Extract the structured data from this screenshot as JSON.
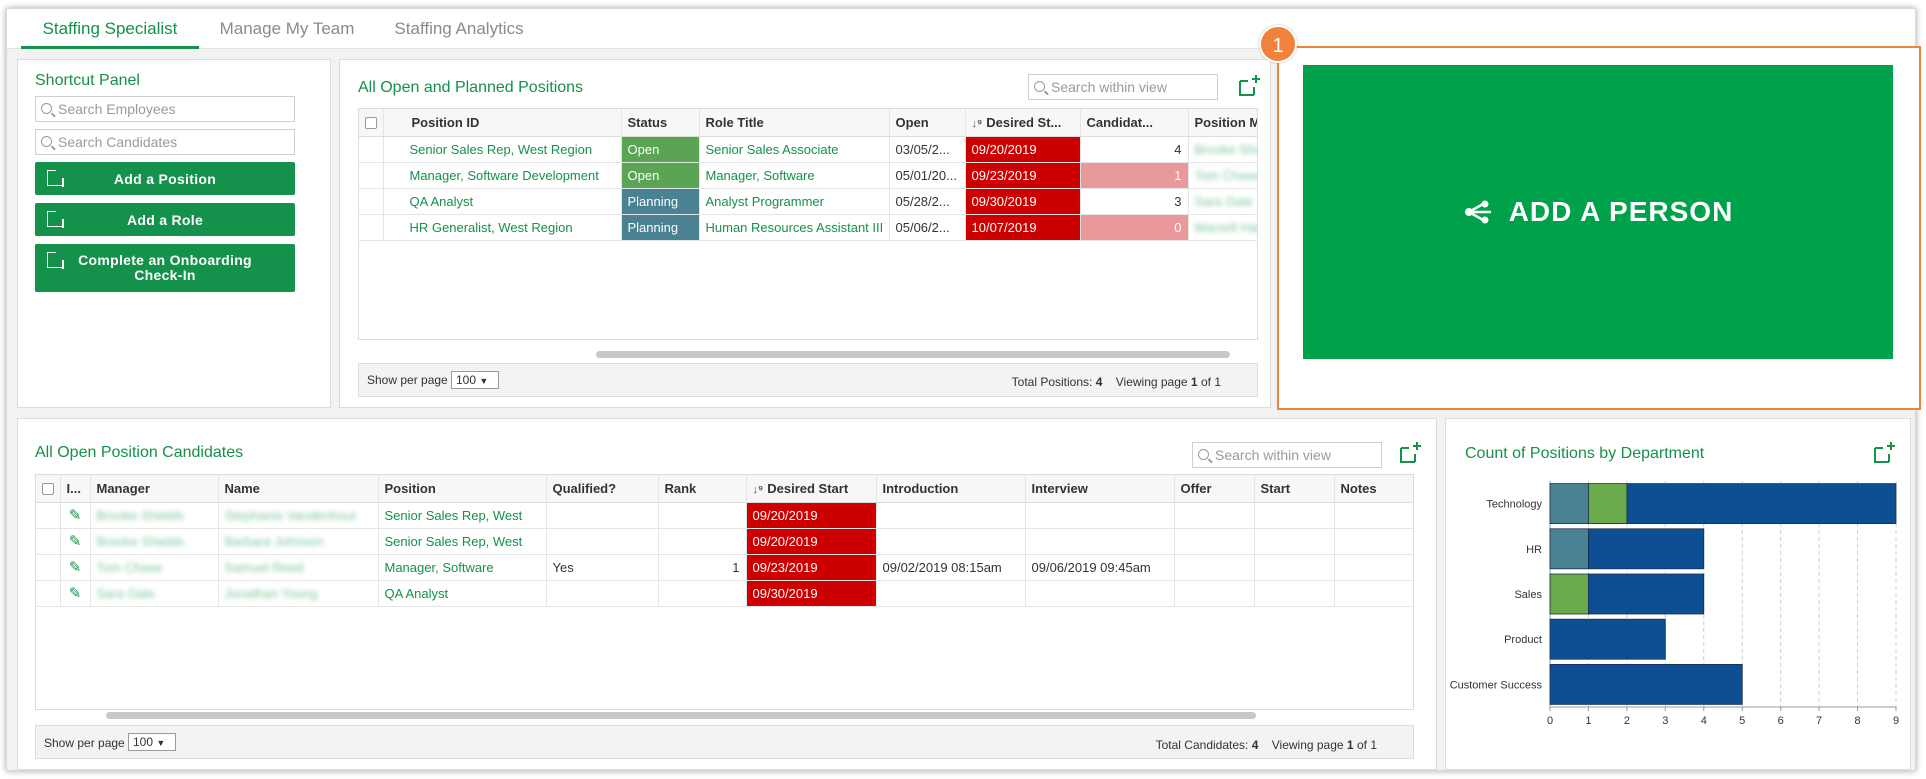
{
  "tabs": [
    {
      "label": "Staffing Specialist",
      "active": true
    },
    {
      "label": "Manage My Team",
      "active": false
    },
    {
      "label": "Staffing Analytics",
      "active": false
    }
  ],
  "shortcut_panel": {
    "title": "Shortcut Panel",
    "search_employees_placeholder": "Search Employees",
    "search_candidates_placeholder": "Search Candidates",
    "buttons": [
      "Add a Position",
      "Add a Role",
      "Complete an Onboarding Check-In"
    ]
  },
  "positions": {
    "title": "All Open and Planned Positions",
    "search_placeholder": "Search within view",
    "columns": [
      "Position ID",
      "Status",
      "Role Title",
      "Open",
      "Desired St...",
      "Candidat...",
      "Position Mana"
    ],
    "rows": [
      {
        "position_id": "Senior Sales Rep, West Region",
        "status": "Open",
        "role_title": "Senior Sales Associate",
        "open": "03/05/2...",
        "desired_start": "09/20/2019",
        "candidates": "4",
        "manager": "Brooke Shields"
      },
      {
        "position_id": "Manager, Software Development",
        "status": "Open",
        "role_title": "Manager, Software",
        "open": "05/01/20...",
        "desired_start": "09/23/2019",
        "candidates": "1",
        "manager": "Tom Chase"
      },
      {
        "position_id": "QA Analyst",
        "status": "Planning",
        "role_title": "Analyst Programmer",
        "open": "05/28/2...",
        "desired_start": "09/30/2019",
        "candidates": "3",
        "manager": "Sara Gale"
      },
      {
        "position_id": "HR Generalist, West Region",
        "status": "Planning",
        "role_title": "Human Resources Assistant III",
        "open": "05/06/2...",
        "desired_start": "10/07/2019",
        "candidates": "0",
        "manager": "Marnell Harris"
      }
    ],
    "show_per_page_label": "Show per page",
    "per_page": "100",
    "total_label": "Total Positions:",
    "total": "4",
    "viewing_label": "Viewing page",
    "page": "1",
    "of_label": "of",
    "pages": "1"
  },
  "add_person": {
    "label": "ADD A PERSON",
    "callout_number": "1",
    "accent": "#f0823c",
    "button_color": "#00a14b"
  },
  "candidates": {
    "title": "All Open Position Candidates",
    "search_placeholder": "Search within view",
    "columns": [
      "I...",
      "Manager",
      "Name",
      "Position",
      "Qualified?",
      "Rank",
      "Desired Start",
      "Introduction",
      "Interview",
      "Offer",
      "Start",
      "Notes"
    ],
    "rows": [
      {
        "manager": "Brooke Shields",
        "name": "Stephanie Vandenhout",
        "position": "Senior Sales Rep, West",
        "qualified": "",
        "rank": "",
        "desired_start": "09/20/2019",
        "introduction": "",
        "interview": "",
        "offer": "",
        "start": "",
        "notes": ""
      },
      {
        "manager": "Brooke Shields",
        "name": "Barbara Johnson",
        "position": "Senior Sales Rep, West",
        "qualified": "",
        "rank": "",
        "desired_start": "09/20/2019",
        "introduction": "",
        "interview": "",
        "offer": "",
        "start": "",
        "notes": ""
      },
      {
        "manager": "Tom Chase",
        "name": "Samuel Reed",
        "position": "Manager, Software",
        "qualified": "Yes",
        "rank": "1",
        "desired_start": "09/23/2019",
        "introduction": "09/02/2019 08:15am",
        "interview": "09/06/2019 09:45am",
        "offer": "",
        "start": "",
        "notes": ""
      },
      {
        "manager": "Sara Gale",
        "name": "Jonathan Young",
        "position": "QA Analyst",
        "qualified": "",
        "rank": "",
        "desired_start": "09/30/2019",
        "introduction": "",
        "interview": "",
        "offer": "",
        "start": "",
        "notes": ""
      }
    ],
    "show_per_page_label": "Show per page",
    "per_page": "100",
    "total_label": "Total Candidates:",
    "total": "4",
    "viewing_label": "Viewing page",
    "page": "1",
    "of_label": "of",
    "pages": "1"
  },
  "chart_data": {
    "type": "bar",
    "orientation": "horizontal",
    "stacked": true,
    "title": "Count of Positions by Department",
    "categories": [
      "Technology",
      "HR",
      "Sales",
      "Product",
      "Customer Success"
    ],
    "series": [
      {
        "color": "#4a8193",
        "values": [
          1,
          1,
          0,
          0,
          0
        ]
      },
      {
        "color": "#6aaa4a",
        "values": [
          1,
          0,
          1,
          0,
          0
        ]
      },
      {
        "color": "#0e4f94",
        "values": [
          7,
          3,
          3,
          3,
          5
        ]
      }
    ],
    "xlim": [
      0,
      9
    ],
    "xticks": [
      "0",
      "1",
      "2",
      "3",
      "4",
      "5",
      "6",
      "7",
      "8",
      "9"
    ],
    "grid": true
  }
}
